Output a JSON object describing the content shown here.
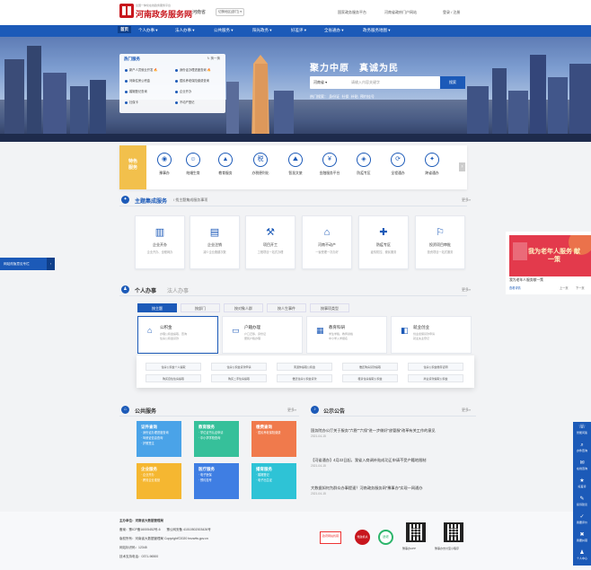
{
  "header": {
    "brand_small": "全国一体化在线政务服务平台",
    "brand": "河南政务服务网",
    "region": "河南省",
    "region_switch": "切换地区(部门) ▾",
    "links": [
      "国家政务服务平台",
      "河南省政府门户网站",
      "登录 / 注册"
    ]
  },
  "nav": {
    "items": [
      "首页",
      "个人办事 ▾",
      "法人办事 ▾",
      "公共服务 ▾",
      "阳光政务 ▾",
      "好差评 ▾",
      "全省通办 ▾",
      "政务服务地图 ▾"
    ]
  },
  "banner": {
    "hot_title": "热门服务",
    "hot_switch": "换一换",
    "hot_items": [
      "新户人员就业开发",
      "身份证办理进度查询",
      "河南住房公积金",
      "居民养老保险缴费查询",
      "婚姻登记查询",
      "企业开办",
      "社保卡",
      "不动产登记"
    ],
    "slogan": "聚力中原　真诚为民",
    "search_select": "河南省 ▾",
    "search_placeholder": "请输入内容关键字",
    "search_button": "搜索",
    "hot_words": [
      "热门搜索：",
      "身份证",
      "社保",
      "补贴",
      "预约挂号"
    ]
  },
  "feature": {
    "tag": "特色服务",
    "items": [
      "豫事办",
      "结婚生育",
      "就业创业",
      "教育服务",
      "办税便利化",
      "智慧文旅",
      "金融服务平台",
      "防疫专区",
      "全程通办",
      "跨省通办"
    ]
  },
  "theme": {
    "title": "主题集成服务",
    "subtitle": "/ 找主题集成服务事项",
    "more": "更多»",
    "cards": [
      {
        "name": "企业开办",
        "desc": "企业开办、全程网办"
      },
      {
        "name": "企业注销",
        "desc": "减少企业跑腿次数"
      },
      {
        "name": "项目开工",
        "desc": "工程项目一站式办理"
      },
      {
        "name": "河南不动产",
        "desc": "一窗受理一次办好"
      },
      {
        "name": "防疫专区",
        "desc": "疫情防控、便民服务"
      },
      {
        "name": "投资项目审批",
        "desc": "投资项目一站式服务"
      }
    ]
  },
  "personal": {
    "title": "个人办事",
    "title2": "法人办事",
    "more": "更多»",
    "tabs": [
      "按主题",
      "按部门",
      "按对象人群",
      "按人生事件",
      "按事项类型"
    ],
    "cards": [
      {
        "name": "公积金",
        "desc1": "办理公积金提取、查询",
        "desc2": "住房公积金贷款"
      },
      {
        "name": "户籍办理",
        "desc1": "户口迁移、身份证",
        "desc2": "居民户籍办理"
      },
      {
        "name": "教育科研",
        "desc1": "学生学籍、教师资格",
        "desc2": "中小学入学报名"
      },
      {
        "name": "就业创业",
        "desc1": "创业担保贷款申请",
        "desc2": "就业失业登记"
      }
    ],
    "dropdown": [
      "住房公积金个人提取",
      "住房公积金贷款申请",
      "离退休提取公积金",
      "偿还购房贷款提取",
      "住房公积金缴存证明",
      "购买自住住房提取",
      "购买二手住房提取",
      "偿还住房公积金贷款",
      "租赁住房提取公积金",
      "商业贷款提取公积金"
    ]
  },
  "public": {
    "title": "公共服务",
    "more": "更多»",
    "tiles": [
      {
        "name": "证件查询",
        "lines": [
          "· 身份证办理进度查询",
          "· 驾驶证信息查询",
          "· 护照签注"
        ]
      },
      {
        "name": "教育服务",
        "lines": [
          "· 学位证书认证申请",
          "· 中小学学校查询"
        ]
      },
      {
        "name": "缴费查询",
        "lines": [
          "· 居民养老保险缴费"
        ]
      },
      {
        "name": "企业服务",
        "lines": [
          "· 企业开办",
          "· 跨省企业准营"
        ]
      },
      {
        "name": "医疗服务",
        "lines": [
          "· 电子医保",
          "· 预约挂号"
        ]
      },
      {
        "name": "婚育服务",
        "lines": [
          "· 婚姻登记",
          "· 电子出生证"
        ]
      }
    ]
  },
  "notices": {
    "title": "公示公告",
    "more": "更多»",
    "items": [
      {
        "text": "国务院办公厅关于服务\"六稳\"\"六保\"进一步做好\"放管服\"改革有关工作的意见",
        "date": "2021-04-15"
      },
      {
        "text": "【河省通办】4月22日起，我省入商调补贴成功正申请不受户籍地限制",
        "date": "2021-04-15"
      },
      {
        "text": "大数据如何为群众办事提速？河南政务服务网\"豫事办\"实现一网通办",
        "date": "2021-04-15"
      }
    ]
  },
  "ad": {
    "headline": "我为老年人服务 献一策",
    "caption": "我为老年人服务献一策",
    "caption_sub": "查看详情",
    "prev": "上一页",
    "next": "下一页"
  },
  "left_float": "网站改版意见专栏",
  "right_bar": [
    "智能问答",
    "办件查询",
    "在线咨询",
    "好差评",
    "投诉建议",
    "我要评价",
    "我要纠错",
    "个人中心"
  ],
  "footer": {
    "lines": [
      "主办单位：河南省大数据管理局",
      "备案：豫ICP备16005452号-6　　豫公网安备 41010502003426号",
      "版权所有：河南省大数据管理局 Copyright©2020 hnzwfw.gov.cn",
      "网站标识码：12345",
      "技术支持电话：0371-96500"
    ],
    "badges": [
      "政府网站找错",
      "党政机关",
      "适老"
    ],
    "qr_labels": [
      "豫事办APP",
      "豫事办支付宝小程序"
    ]
  }
}
